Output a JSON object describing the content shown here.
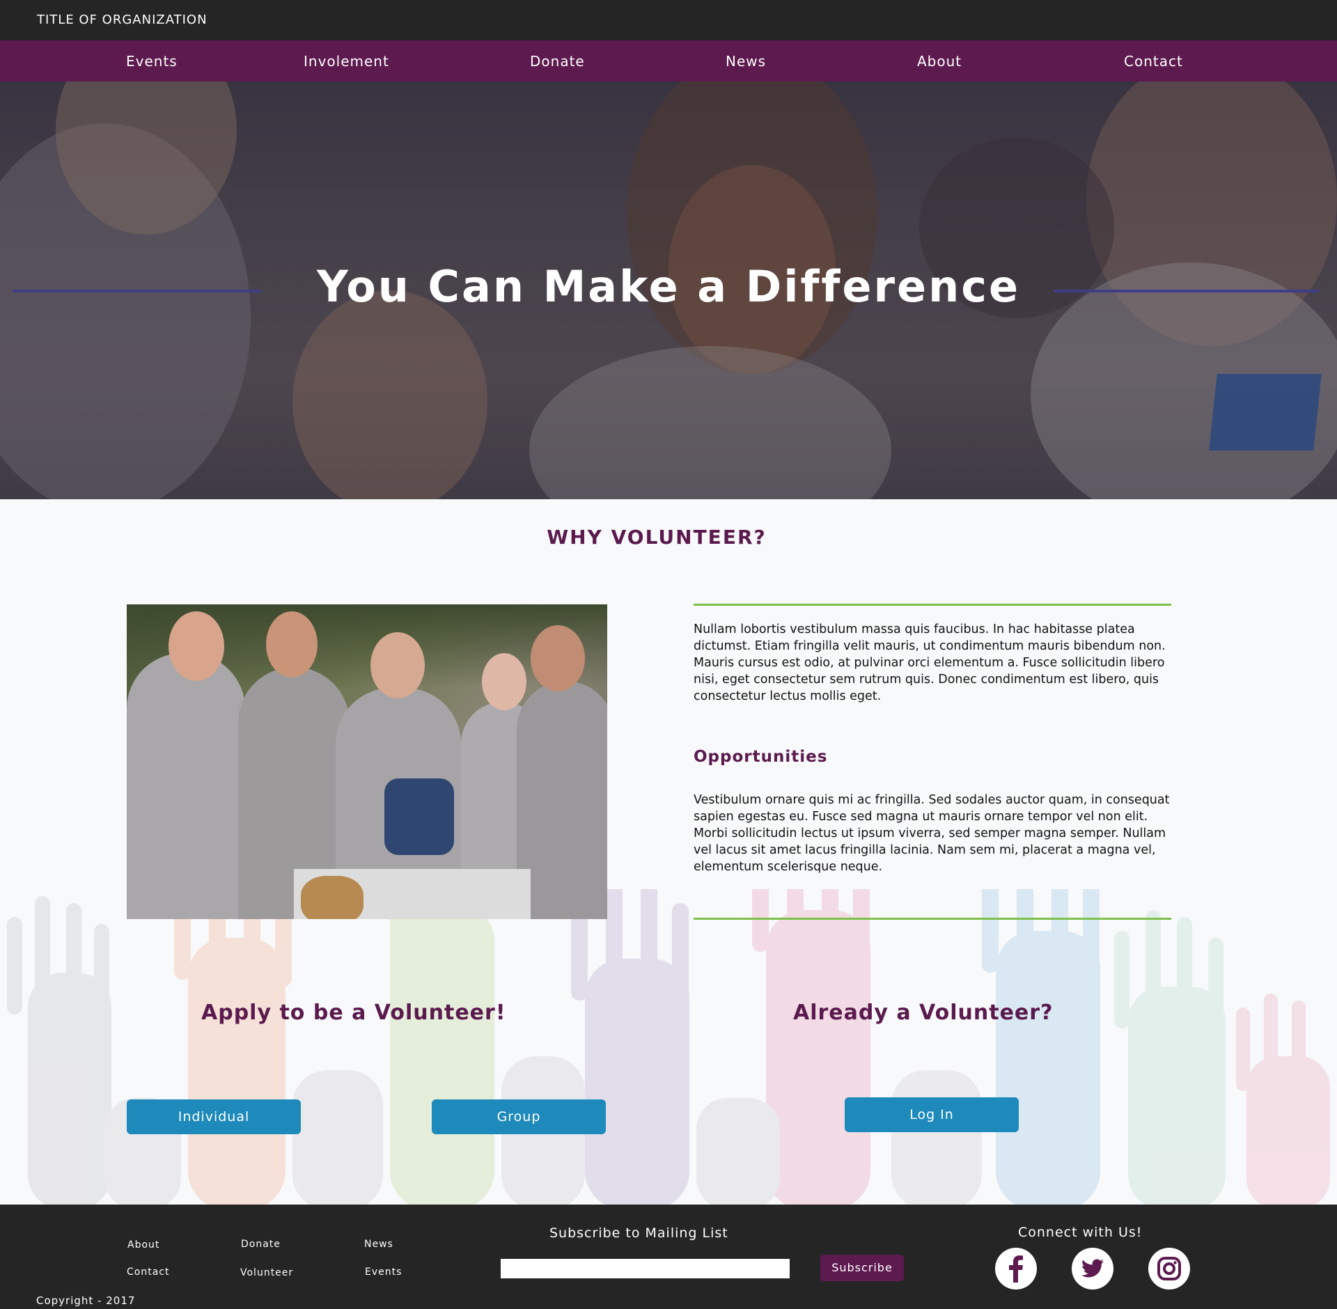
{
  "header": {
    "org_title": "TITLE OF ORGANIZATION"
  },
  "nav": {
    "items": [
      {
        "label": "Events"
      },
      {
        "label": "Involement"
      },
      {
        "label": "Donate"
      },
      {
        "label": "News"
      },
      {
        "label": "About"
      },
      {
        "label": "Contact"
      }
    ]
  },
  "hero": {
    "title": "You Can Make a Difference"
  },
  "main": {
    "section_title": "WHY VOLUNTEER?",
    "intro_text": "Nullam lobortis vestibulum massa quis faucibus. In hac habitasse platea dictumst. Etiam fringilla velit mauris, ut condimentum mauris bibendum non. Mauris cursus est odio, at pulvinar orci elementum a. Fusce sollicitudin libero nisi, eget consectetur sem rutrum quis. Donec condimentum est libero, quis consectetur lectus mollis eget.",
    "opportunities_title": "Opportunities",
    "opportunities_text": "Vestibulum ornare quis mi ac fringilla. Sed sodales auctor quam, in consequat sapien egestas eu. Fusce sed magna ut mauris ornare tempor vel non elit. Morbi sollicitudin lectus ut ipsum viverra, sed semper magna semper. Nullam vel lacus sit amet lacus fringilla lacinia. Nam sem mi, placerat a magna vel, elementum scelerisque neque.",
    "apply_title": "Apply to be a Volunteer!",
    "already_title": "Already a Volunteer?",
    "individual_label": "Individual",
    "group_label": "Group",
    "login_label": "Log In"
  },
  "footer": {
    "links": [
      {
        "label": "About"
      },
      {
        "label": "Donate"
      },
      {
        "label": "News"
      },
      {
        "label": "Contact"
      },
      {
        "label": "Volunteer"
      },
      {
        "label": "Events"
      }
    ],
    "subscribe_title": "Subscribe to Mailing List",
    "subscribe_input_placeholder": "",
    "subscribe_button": "Subscribe",
    "connect_title": "Connect with Us!",
    "social_icons": [
      "facebook-icon",
      "twitter-icon",
      "instagram-icon"
    ],
    "copyright": "Copyright - 2017"
  },
  "colors": {
    "topbar": "#252525",
    "nav": "#5d1a4f",
    "accent_purple": "#5a1a4e",
    "button_blue": "#1d8abb",
    "divider_green": "#7dc14b",
    "hero_line": "#3f3d86"
  }
}
